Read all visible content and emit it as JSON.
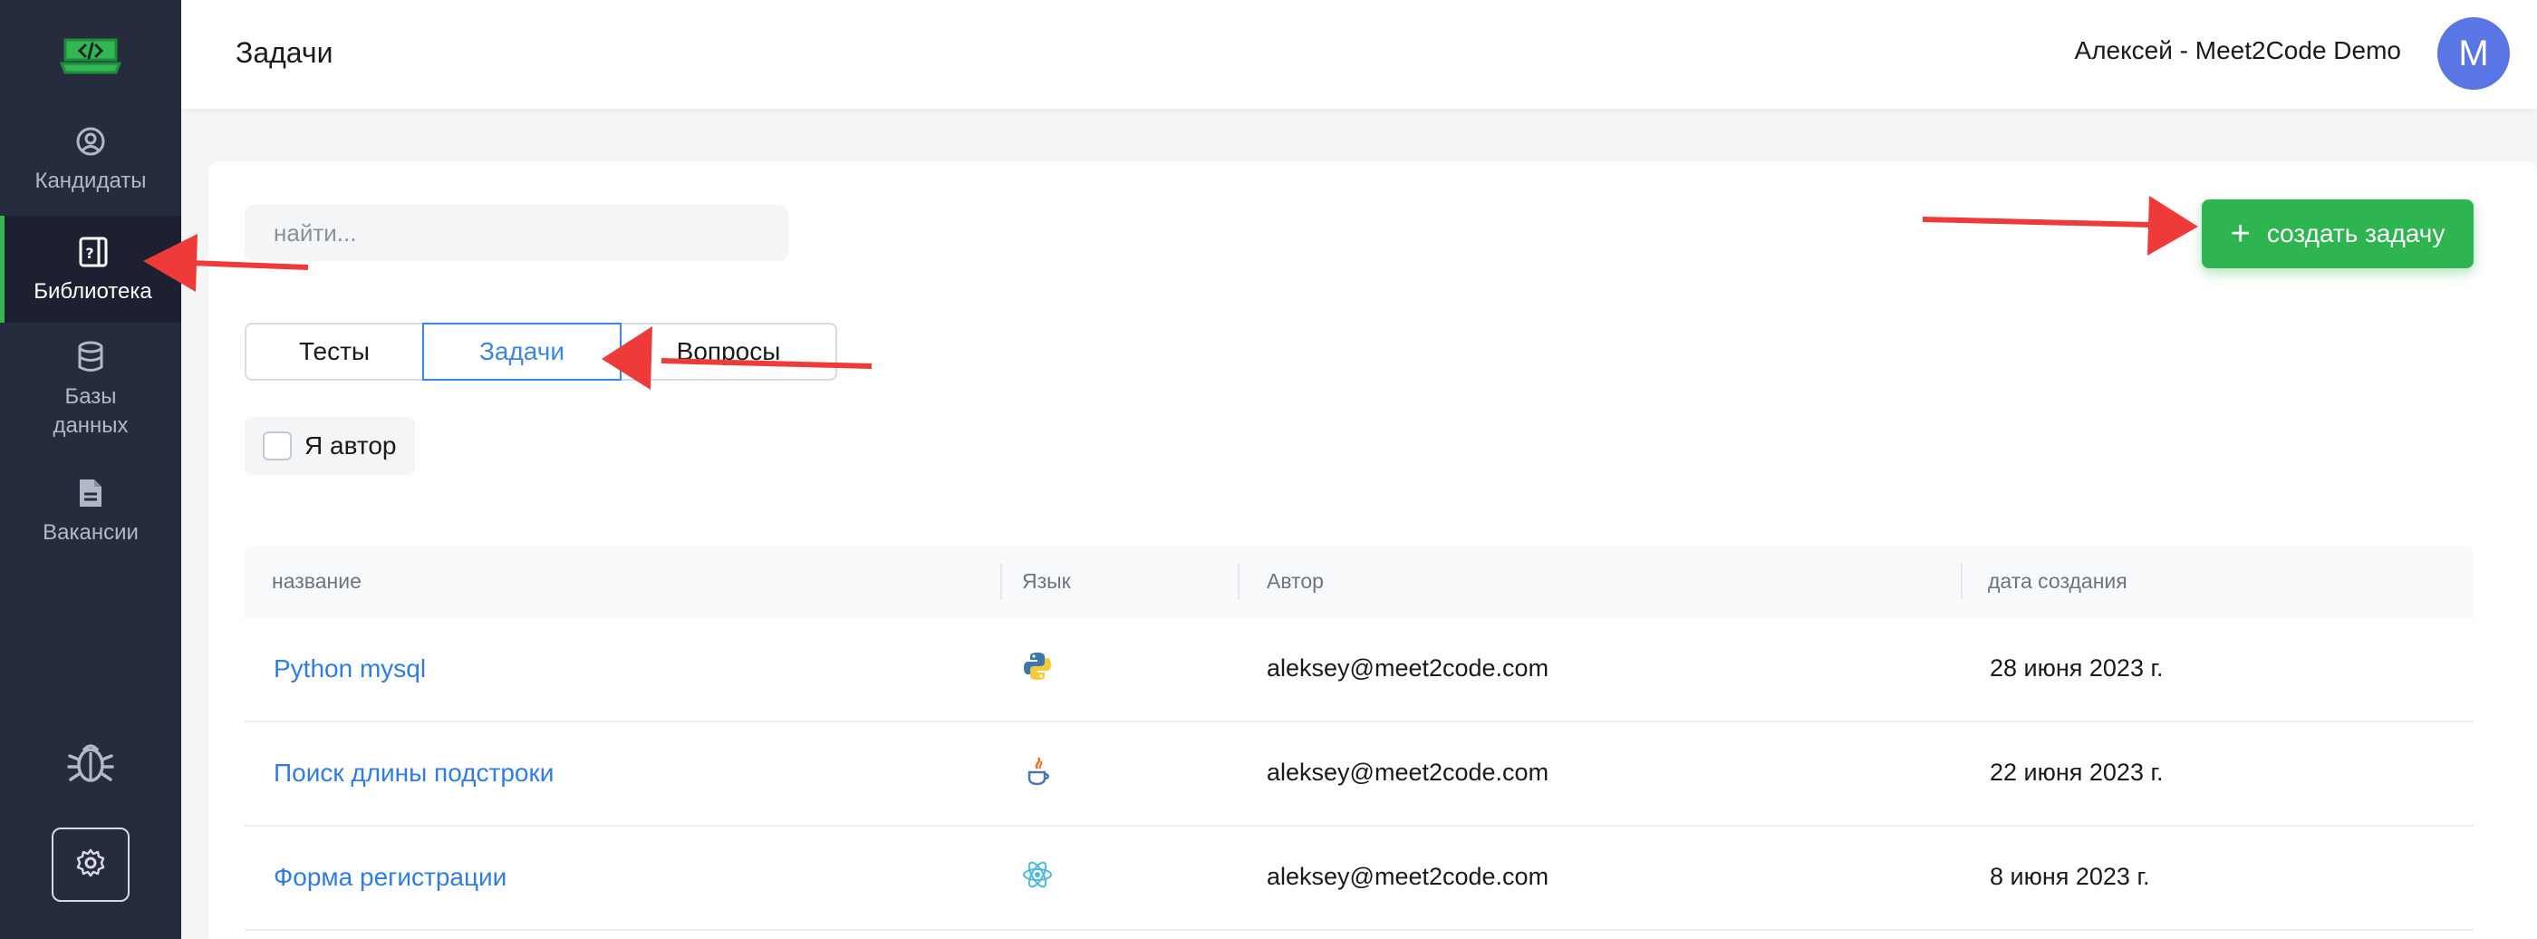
{
  "app": {
    "brand_color": "#33b653",
    "accent": "#3b86e0"
  },
  "sidebar": {
    "items": [
      {
        "label": "Кандидаты",
        "icon": "user-circle-icon"
      },
      {
        "label": "Библиотека",
        "icon": "question-book-icon",
        "active": true
      },
      {
        "label": "Базы данных",
        "icon": "database-icon"
      },
      {
        "label": "Вакансии",
        "icon": "document-icon"
      }
    ],
    "bottom": [
      {
        "icon": "bug-icon"
      },
      {
        "icon": "gear-icon"
      }
    ]
  },
  "header": {
    "title": "Задачи",
    "user": "Алексей - Meet2Code Demo",
    "avatar_letter": "M"
  },
  "search": {
    "placeholder": "найти..."
  },
  "create_button": {
    "label": "создать задачу",
    "icon": "plus-icon"
  },
  "tabs": [
    {
      "label": "Тесты"
    },
    {
      "label": "Задачи",
      "active": true
    },
    {
      "label": "Вопросы"
    }
  ],
  "filter": {
    "label": "Я автор",
    "checked": false
  },
  "table": {
    "columns": [
      "название",
      "Язык",
      "Автор",
      "дата создания"
    ],
    "rows": [
      {
        "name": "Python mysql",
        "language_icon": "python-icon",
        "author": "aleksey@meet2code.com",
        "created": "28 июня 2023 г."
      },
      {
        "name": "Поиск длины подстроки",
        "language_icon": "java-icon",
        "author": "aleksey@meet2code.com",
        "created": "22 июня 2023 г."
      },
      {
        "name": "Форма регистрации",
        "language_icon": "react-icon",
        "author": "aleksey@meet2code.com",
        "created": "8 июня 2023 г."
      }
    ]
  }
}
